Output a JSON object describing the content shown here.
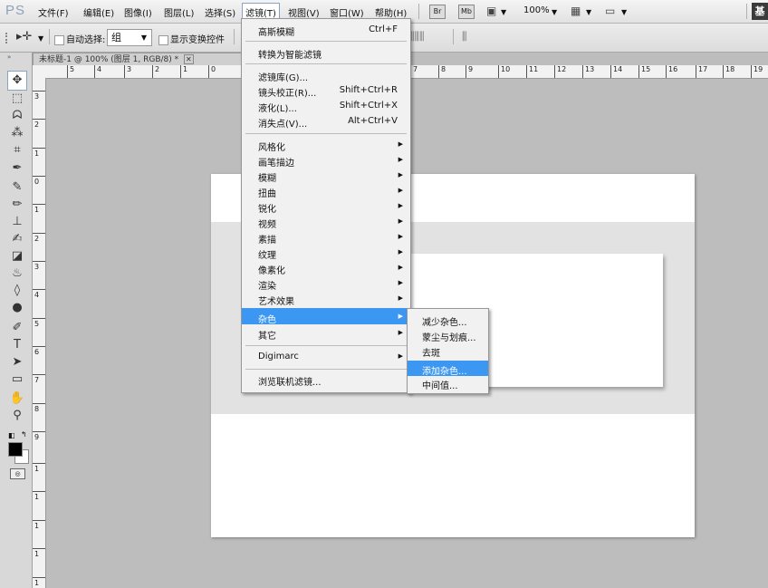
{
  "app_logo": "PS",
  "menubar": {
    "items": [
      "文件(F)",
      "编辑(E)",
      "图像(I)",
      "图层(L)",
      "选择(S)",
      "滤镜(T)",
      "视图(V)",
      "窗口(W)",
      "帮助(H)"
    ],
    "bridge_label": "Br",
    "minibridge_label": "Mb",
    "zoom": "100%",
    "workspace": "基"
  },
  "options": {
    "auto_select_label": "自动选择:",
    "auto_select_value": "组",
    "show_transform_label": "显示变换控件"
  },
  "document": {
    "tab_title": "未标题-1 @ 100% (图层 1, RGB/8) *",
    "hruler_labels": [
      "5",
      "4",
      "3",
      "2",
      "1",
      "0",
      "7",
      "8",
      "9",
      "10",
      "11",
      "12",
      "13",
      "14",
      "15",
      "16",
      "17",
      "18",
      "19"
    ],
    "vruler_labels": [
      "3",
      "2",
      "1",
      "0",
      "1",
      "2",
      "3",
      "4",
      "5",
      "6",
      "7",
      "8",
      "9",
      "1",
      "1",
      "1",
      "1",
      "1"
    ]
  },
  "filter_menu": {
    "last_filter": "高斯模糊",
    "last_filter_shortcut": "Ctrl+F",
    "convert_smart": "转换为智能滤镜",
    "gallery": "滤镜库(G)...",
    "lens_correction": "镜头校正(R)...",
    "lens_correction_shortcut": "Shift+Ctrl+R",
    "liquify": "液化(L)...",
    "liquify_shortcut": "Shift+Ctrl+X",
    "vanishing_point": "消失点(V)...",
    "vanishing_point_shortcut": "Alt+Ctrl+V",
    "groups": [
      "风格化",
      "画笔描边",
      "模糊",
      "扭曲",
      "锐化",
      "视频",
      "素描",
      "纹理",
      "像素化",
      "渲染",
      "艺术效果",
      "杂色",
      "其它"
    ],
    "digimarc": "Digimarc",
    "browse_online": "浏览联机滤镜..."
  },
  "noise_submenu": {
    "items": [
      "减少杂色...",
      "蒙尘与划痕...",
      "去斑",
      "添加杂色...",
      "中间值..."
    ]
  },
  "colors": {
    "highlight": "#3b97f2",
    "canvas_bg": "#bdbdbd"
  }
}
